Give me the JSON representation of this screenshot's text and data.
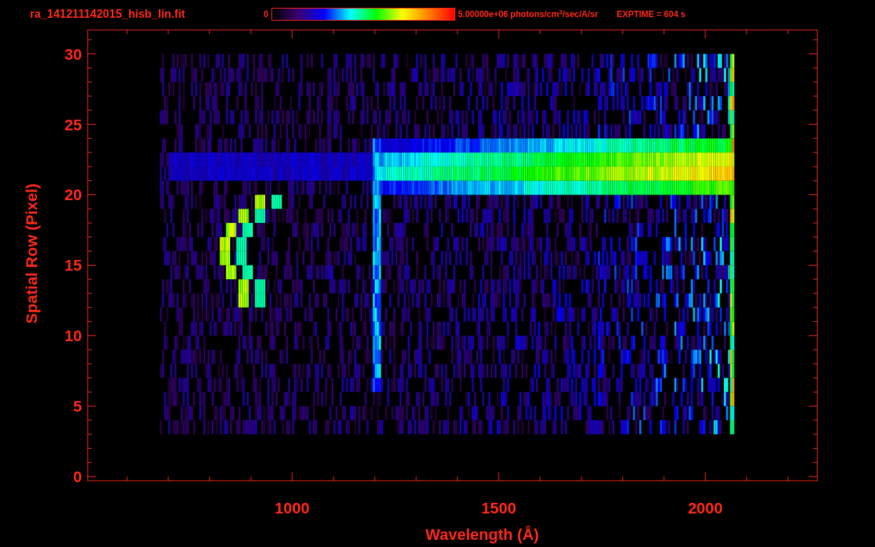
{
  "title": "ra_141211142015_hisb_lin.fit",
  "colorbar": {
    "min_label": "0",
    "max_label": "5.00000e+06 photons/cm$^{2}$/sec/A/sr"
  },
  "exptime": "EXPTIME = 604 s",
  "plot": {
    "ylabel": "Spatial Row (Pixel)",
    "xlabel": "Wavelength (Å)",
    "yticks": [
      "30",
      "25",
      "20",
      "15",
      "10",
      "5",
      "0"
    ],
    "xticks": [
      "1000",
      "1500",
      "2000"
    ]
  }
}
